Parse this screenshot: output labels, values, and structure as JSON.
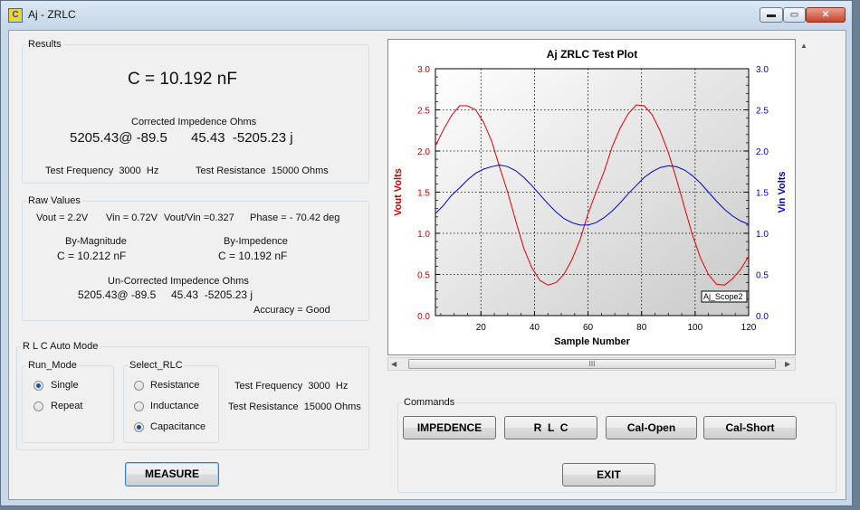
{
  "window": {
    "title": "Aj - ZRLC",
    "icon_label": "C",
    "minimize": "▬",
    "maximize": "▭",
    "close": "✕"
  },
  "results": {
    "legend": "Results",
    "capacitance": "C = 10.192 nF",
    "corrected_title": "Corrected Impedence Ohms",
    "corrected_polar": "5205.43@ -89.5",
    "corrected_rect": "45.43  -5205.23 j",
    "test_frequency": "Test Frequency  3000  Hz",
    "test_resistance": "Test Resistance  15000 Ohms"
  },
  "raw": {
    "legend": "Raw Values",
    "vout": "Vout = 2.2V",
    "vin": "Vin = 0.72V",
    "ratio": "Vout/Vin =0.327",
    "phase": "Phase = - 70.42 deg",
    "by_magnitude_label": "By-Magnitude",
    "by_magnitude_value": "C = 10.212 nF",
    "by_impedence_label": "By-Impedence",
    "by_impedence_value": "C = 10.192 nF",
    "uncorrected_title": "Un-Corrected Impedence Ohms",
    "uncorrected_polar": "5205.43@ -89.5",
    "uncorrected_rect": "45.43  -5205.23 j",
    "accuracy": "Accuracy = Good"
  },
  "auto_mode": {
    "legend": "R L C Auto Mode",
    "run_mode": {
      "legend": "Run_Mode",
      "options": [
        {
          "label": "Single",
          "checked": true
        },
        {
          "label": "Repeat",
          "checked": false
        }
      ]
    },
    "select_rlc": {
      "legend": "Select_RLC",
      "options": [
        {
          "label": "Resistance",
          "checked": false
        },
        {
          "label": "Inductance",
          "checked": false
        },
        {
          "label": "Capacitance",
          "checked": true
        }
      ]
    },
    "test_frequency": "Test Frequency  3000  Hz",
    "test_resistance": "Test Resistance  15000 Ohms"
  },
  "measure_button": "MEASURE",
  "commands": {
    "legend": "Commands",
    "impedence": "IMPEDENCE",
    "rlc": "R  L  C",
    "cal_open": "Cal-Open",
    "cal_short": "Cal-Short",
    "exit": "EXIT"
  },
  "scroll_thumb_glyph": "III",
  "colors": {
    "vout": "#e00000",
    "vin": "#0000d0",
    "accent": "#3c7fb1"
  },
  "chart_data": {
    "type": "line",
    "title": "Aj ZRLC Test Plot",
    "xlabel": "Sample Number",
    "ylabel_left": "Vout Volts",
    "ylabel_right": "Vin Volts",
    "xlim": [
      3,
      120
    ],
    "ylim": [
      0,
      3
    ],
    "x_ticks": [
      20,
      40,
      60,
      80,
      100,
      120
    ],
    "y_ticks": [
      "0.0",
      "0.5",
      "1.0",
      "1.5",
      "2.0",
      "2.5",
      "3.0"
    ],
    "grid": true,
    "legend_box": "Aj_Scope2",
    "series": [
      {
        "axis": "left",
        "color": "#e00000",
        "x": [
          3,
          6,
          9,
          12,
          15,
          18,
          21,
          24,
          27,
          30,
          33,
          36,
          39,
          42,
          45,
          48,
          51,
          54,
          57,
          60,
          63,
          66,
          69,
          72,
          75,
          78,
          81,
          84,
          87,
          90,
          93,
          96,
          99,
          102,
          105,
          108,
          111,
          114,
          117,
          120
        ],
        "values": [
          2.06,
          2.26,
          2.43,
          2.55,
          2.55,
          2.5,
          2.35,
          2.12,
          1.8,
          1.5,
          1.15,
          0.82,
          0.58,
          0.43,
          0.37,
          0.4,
          0.5,
          0.68,
          0.92,
          1.24,
          1.5,
          1.75,
          2.05,
          2.28,
          2.45,
          2.56,
          2.55,
          2.44,
          2.24,
          1.98,
          1.66,
          1.32,
          0.98,
          0.7,
          0.5,
          0.38,
          0.37,
          0.45,
          0.56,
          0.72
        ]
      },
      {
        "axis": "right",
        "color": "#0000d0",
        "x": [
          3,
          6,
          9,
          12,
          15,
          18,
          21,
          24,
          27,
          30,
          33,
          36,
          39,
          42,
          45,
          48,
          51,
          54,
          57,
          60,
          63,
          66,
          69,
          72,
          75,
          78,
          81,
          84,
          87,
          90,
          93,
          96,
          99,
          102,
          105,
          108,
          111,
          114,
          117,
          120
        ],
        "values": [
          1.24,
          1.34,
          1.46,
          1.55,
          1.65,
          1.73,
          1.78,
          1.81,
          1.83,
          1.81,
          1.76,
          1.68,
          1.58,
          1.47,
          1.36,
          1.26,
          1.18,
          1.13,
          1.1,
          1.1,
          1.13,
          1.19,
          1.27,
          1.37,
          1.48,
          1.58,
          1.68,
          1.75,
          1.8,
          1.82,
          1.81,
          1.77,
          1.7,
          1.61,
          1.5,
          1.39,
          1.29,
          1.21,
          1.15,
          1.11
        ]
      }
    ]
  }
}
